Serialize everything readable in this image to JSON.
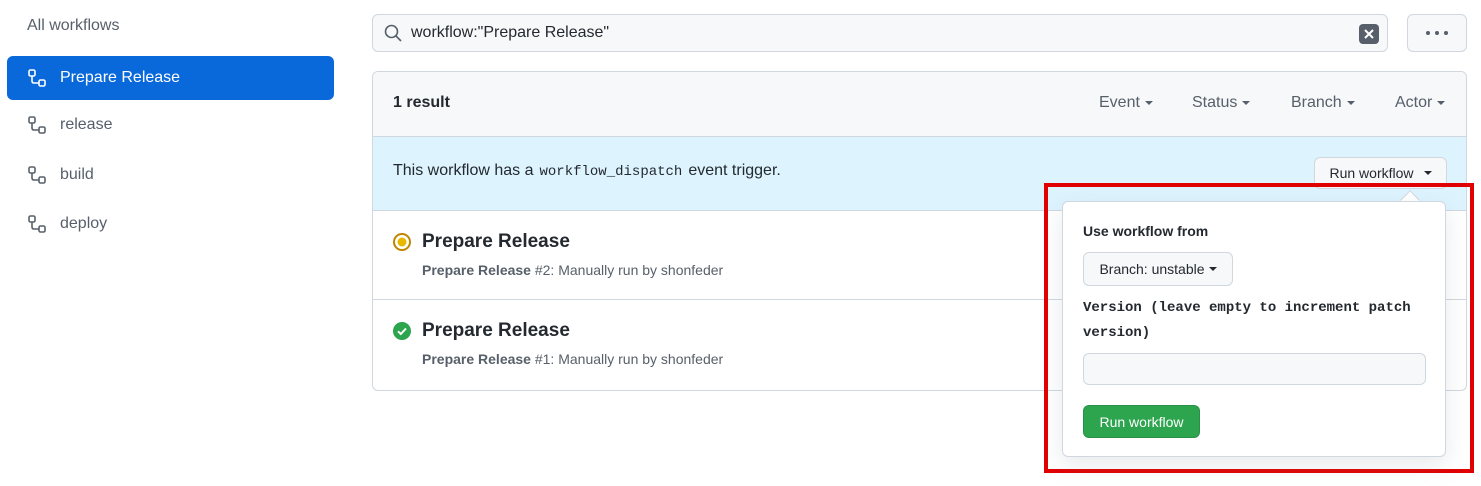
{
  "sidebar": {
    "all_workflows": "All workflows",
    "items": [
      {
        "label": "Prepare Release",
        "active": true,
        "icon": "workflow-icon"
      },
      {
        "label": "release",
        "active": false,
        "icon": "workflow-icon"
      },
      {
        "label": "build",
        "active": false,
        "icon": "workflow-icon"
      },
      {
        "label": "deploy",
        "active": false,
        "icon": "workflow-icon"
      }
    ]
  },
  "search": {
    "value": "workflow:\"Prepare Release\"",
    "icon": "search-icon",
    "clear_icon": "clear-icon"
  },
  "more_menu": {
    "icon": "kebab-horizontal-icon"
  },
  "results": {
    "count_label": "1 result",
    "filters": [
      "Event",
      "Status",
      "Branch",
      "Actor"
    ],
    "dispatch": {
      "text_before": "This workflow has a",
      "code": "workflow_dispatch",
      "text_after": "event trigger.",
      "run_button": "Run workflow"
    },
    "runs": [
      {
        "title": "Prepare Release",
        "workflow": "Prepare Release",
        "meta": "#2: Manually run by shonfeder",
        "status": "in-progress",
        "status_color": "#bf8700"
      },
      {
        "title": "Prepare Release",
        "workflow": "Prepare Release",
        "meta": "#1: Manually run by shonfeder",
        "status": "success",
        "status_color": "#2da44e"
      }
    ]
  },
  "popover": {
    "heading": "Use workflow from",
    "branch_button": "Branch: unstable",
    "version_label": "Version (leave empty to increment patch version)",
    "version_value": "",
    "submit": "Run workflow"
  },
  "colors": {
    "accent": "#0969da",
    "info_bg": "#ddf4ff",
    "success": "#2da44e",
    "highlight_border": "#e00000"
  }
}
